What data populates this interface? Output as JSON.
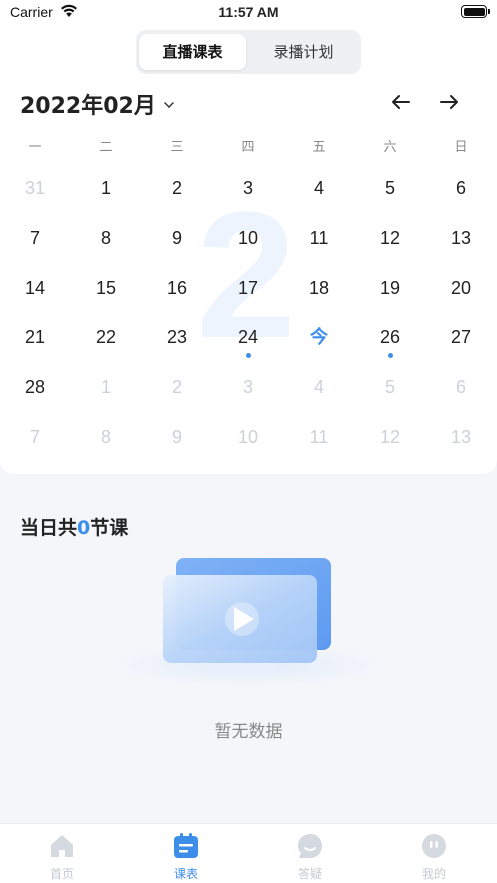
{
  "status_bar": {
    "carrier": "Carrier",
    "time": "11:57 AM"
  },
  "segments": [
    {
      "label": "直播课表",
      "active": true
    },
    {
      "label": "录播计划",
      "active": false
    }
  ],
  "calendar": {
    "month_label": "2022年02月",
    "prev_icon": "arrow-left-icon",
    "next_icon": "arrow-right-icon",
    "background_number": "2",
    "weekdays": [
      "一",
      "二",
      "三",
      "四",
      "五",
      "六",
      "日"
    ],
    "weeks": [
      [
        {
          "t": "31",
          "f": true
        },
        {
          "t": "1"
        },
        {
          "t": "2"
        },
        {
          "t": "3"
        },
        {
          "t": "4"
        },
        {
          "t": "5"
        },
        {
          "t": "6"
        }
      ],
      [
        {
          "t": "7"
        },
        {
          "t": "8"
        },
        {
          "t": "9"
        },
        {
          "t": "10"
        },
        {
          "t": "11"
        },
        {
          "t": "12"
        },
        {
          "t": "13"
        }
      ],
      [
        {
          "t": "14"
        },
        {
          "t": "15"
        },
        {
          "t": "16"
        },
        {
          "t": "17"
        },
        {
          "t": "18"
        },
        {
          "t": "19"
        },
        {
          "t": "20"
        }
      ],
      [
        {
          "t": "21"
        },
        {
          "t": "22"
        },
        {
          "t": "23"
        },
        {
          "t": "24",
          "dot": true
        },
        {
          "t": "今",
          "today": true
        },
        {
          "t": "26",
          "dot": true
        },
        {
          "t": "27"
        }
      ],
      [
        {
          "t": "28"
        },
        {
          "t": "1",
          "f": true
        },
        {
          "t": "2",
          "f": true
        },
        {
          "t": "3",
          "f": true
        },
        {
          "t": "4",
          "f": true
        },
        {
          "t": "5",
          "f": true
        },
        {
          "t": "6",
          "f": true
        }
      ],
      [
        {
          "t": "7",
          "f": true
        },
        {
          "t": "8",
          "f": true
        },
        {
          "t": "9",
          "f": true
        },
        {
          "t": "10",
          "f": true
        },
        {
          "t": "11",
          "f": true
        },
        {
          "t": "12",
          "f": true
        },
        {
          "t": "13",
          "f": true
        }
      ]
    ]
  },
  "summary": {
    "prefix": "当日共",
    "count": "0",
    "suffix": "节课"
  },
  "empty_state": {
    "icon": "video-play-icon",
    "text": "暂无数据"
  },
  "tabbar": [
    {
      "label": "首页",
      "icon": "home-icon",
      "active": false
    },
    {
      "label": "课表",
      "icon": "schedule-icon",
      "active": true
    },
    {
      "label": "答疑",
      "icon": "chat-bubble-icon",
      "active": false
    },
    {
      "label": "我的",
      "icon": "profile-icon",
      "active": false
    }
  ],
  "colors": {
    "accent": "#3d8ee8",
    "faded": "#cdd1d8",
    "page_bg": "#f4f6fa"
  }
}
